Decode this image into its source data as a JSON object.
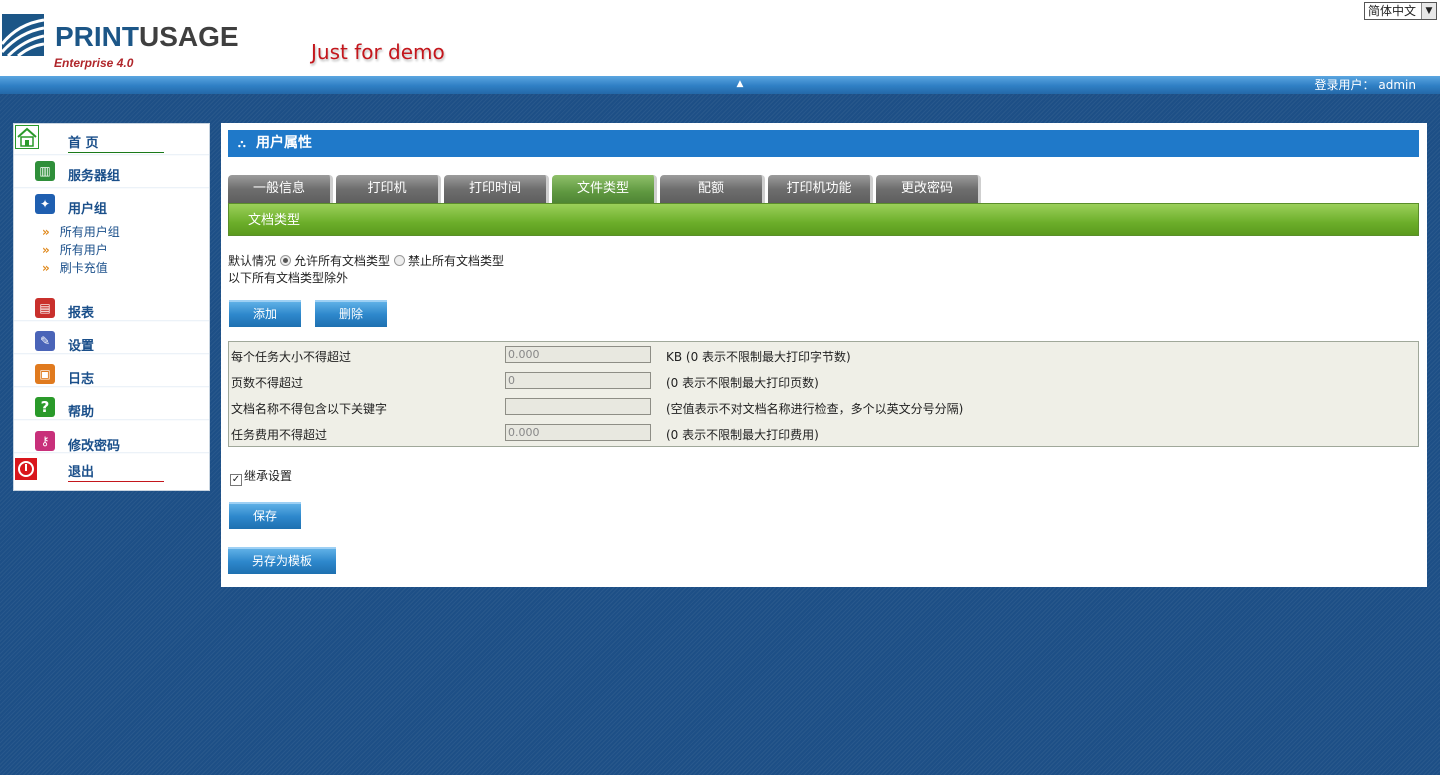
{
  "header": {
    "brand_main": "PRINT",
    "brand_accent": "USAGE",
    "brand_sub": "Enterprise 4.0",
    "demo_note": "Just for demo",
    "language": "简体中文",
    "login_label": "登录用户：",
    "login_user": "admin"
  },
  "sidebar": {
    "items": [
      {
        "label": "首 页",
        "icon": "home-icon"
      },
      {
        "label": "服务器组",
        "icon": "server-group-icon"
      },
      {
        "label": "用户组",
        "icon": "user-group-icon"
      },
      {
        "label": "报表",
        "icon": "report-icon"
      },
      {
        "label": "设置",
        "icon": "settings-icon"
      },
      {
        "label": "日志",
        "icon": "log-icon"
      },
      {
        "label": "帮助",
        "icon": "help-icon"
      },
      {
        "label": "修改密码",
        "icon": "key-icon"
      },
      {
        "label": "退出",
        "icon": "power-icon"
      }
    ],
    "sub_items": [
      "所有用户组",
      "所有用户",
      "刷卡充值"
    ]
  },
  "panel": {
    "title": "用户属性",
    "tabs": [
      "一般信息",
      "打印机",
      "打印时间",
      "文件类型",
      "配额",
      "打印机功能",
      "更改密码"
    ],
    "active_tab": "文件类型",
    "section": "文档类型",
    "default_label": "默认情况",
    "allow_all": "允许所有文档类型",
    "deny_all": "禁止所有文档类型",
    "except_note": "以下所有文档类型除外",
    "add_button": "添加",
    "delete_button": "删除",
    "limits": [
      {
        "label": "每个任务大小不得超过",
        "value": "0.000",
        "hint": "KB (0 表示不限制最大打印字节数)"
      },
      {
        "label": "页数不得超过",
        "value": "0",
        "hint": "(0 表示不限制最大打印页数)"
      },
      {
        "label": "文档名称不得包含以下关键字",
        "value": "",
        "hint": "(空值表示不对文档名称进行检查，多个以英文分号分隔)"
      },
      {
        "label": "任务费用不得超过",
        "value": "0.000",
        "hint": "(0 表示不限制最大打印费用)"
      }
    ],
    "inherit_label": "继承设置",
    "inherit_checked": true,
    "save_button": "保存",
    "save_template_button": "另存为模板"
  }
}
